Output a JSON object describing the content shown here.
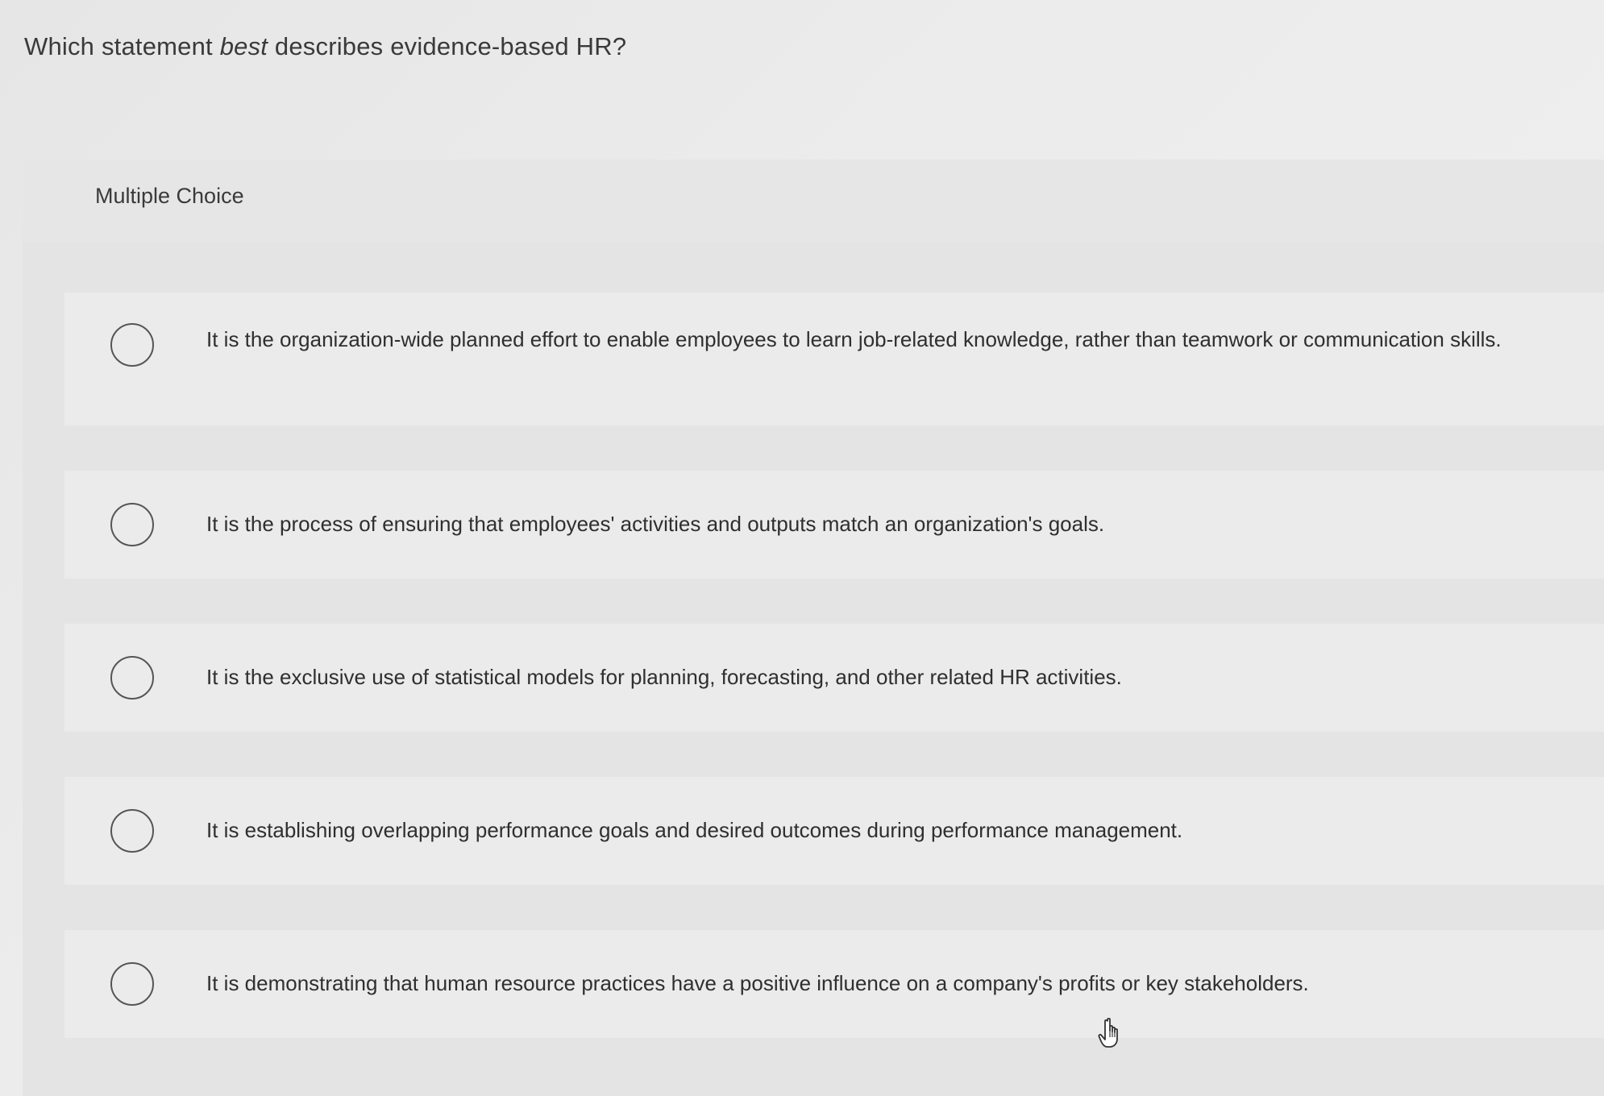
{
  "question": {
    "prefix": "Which statement ",
    "emphasis": "best",
    "suffix": " describes evidence-based HR?"
  },
  "panel": {
    "label": "Multiple Choice"
  },
  "choices": [
    {
      "text": "It is the organization-wide planned effort to enable employees to learn job-related knowledge, rather than teamwork or communication skills."
    },
    {
      "text": "It is the process of ensuring that employees' activities and outputs match an organization's goals."
    },
    {
      "text": "It is the exclusive use of statistical models for planning, forecasting, and other related HR activities."
    },
    {
      "text": "It is establishing overlapping performance goals and desired outcomes during performance management."
    },
    {
      "text": "It is demonstrating that human resource practices have a positive influence on a company's profits or key stakeholders."
    }
  ],
  "icons": {
    "cursor": "hand-pointer-icon",
    "radio": "radio-unchecked-icon"
  }
}
